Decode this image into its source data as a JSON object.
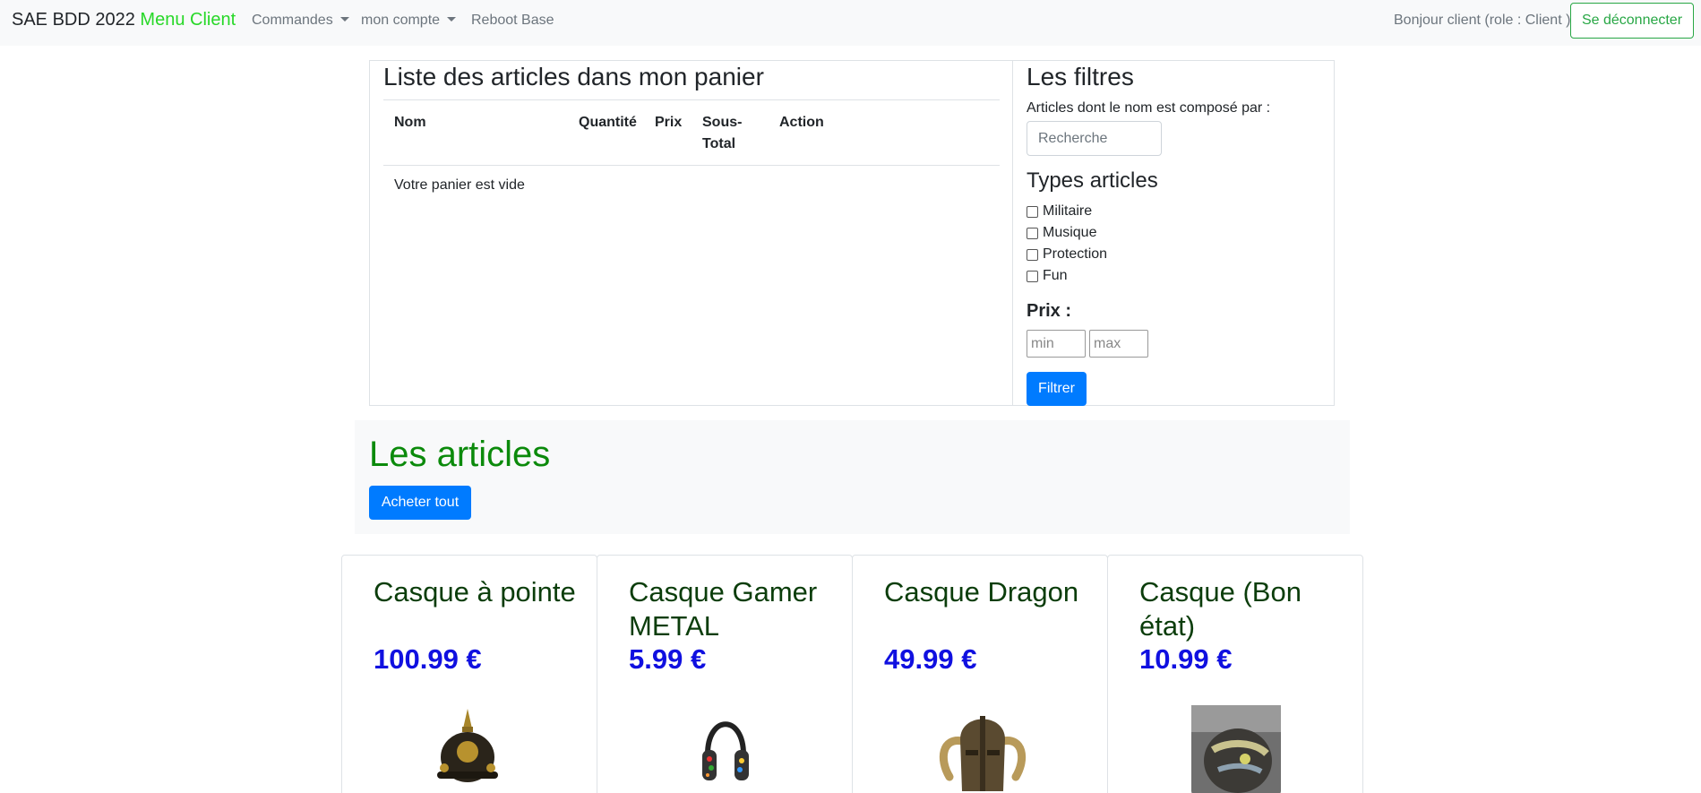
{
  "navbar": {
    "brand_main": "SAE BDD 2022",
    "brand_accent": "Menu Client",
    "commandes": "Commandes",
    "mon_compte": "mon compte",
    "reboot": "Reboot Base",
    "greeting": "Bonjour client (role : Client )",
    "logout": "Se déconnecter"
  },
  "cart": {
    "title": "Liste des articles dans mon panier",
    "columns": {
      "nom": "Nom",
      "quantite": "Quantité",
      "prix": "Prix",
      "sous_total_1": "Sous-",
      "sous_total_2": "Total",
      "action": "Action"
    },
    "empty_message": "Votre panier est vide"
  },
  "filters": {
    "title": "Les filtres",
    "name_label": "Articles dont le nom est composé par :",
    "search_placeholder": "Recherche",
    "types_title": "Types articles",
    "types": [
      "Militaire",
      "Musique",
      "Protection",
      "Fun"
    ],
    "price_label": "Prix :",
    "min_placeholder": "min",
    "max_placeholder": "max",
    "submit": "Filtrer"
  },
  "articles": {
    "title": "Les articles",
    "buy_all": "Acheter tout",
    "items": [
      {
        "name": "Casque à pointe",
        "price": "100.99 €",
        "icon": "pickelhaube-helmet-icon"
      },
      {
        "name": "Casque Gamer METAL",
        "price": "5.99 €",
        "icon": "headphones-icon"
      },
      {
        "name": "Casque Dragon",
        "price": "49.99 €",
        "icon": "horned-helmet-icon"
      },
      {
        "name": "Casque (Bon état)",
        "price": "10.99 €",
        "icon": "motorcycle-helmet-photo-icon"
      }
    ]
  },
  "colors": {
    "brand_accent": "#28d828",
    "primary": "#007bff",
    "logout": "#28a745",
    "articles_title": "#0b8a0b",
    "price": "#1010e0",
    "card_title": "#0b3d0b"
  }
}
